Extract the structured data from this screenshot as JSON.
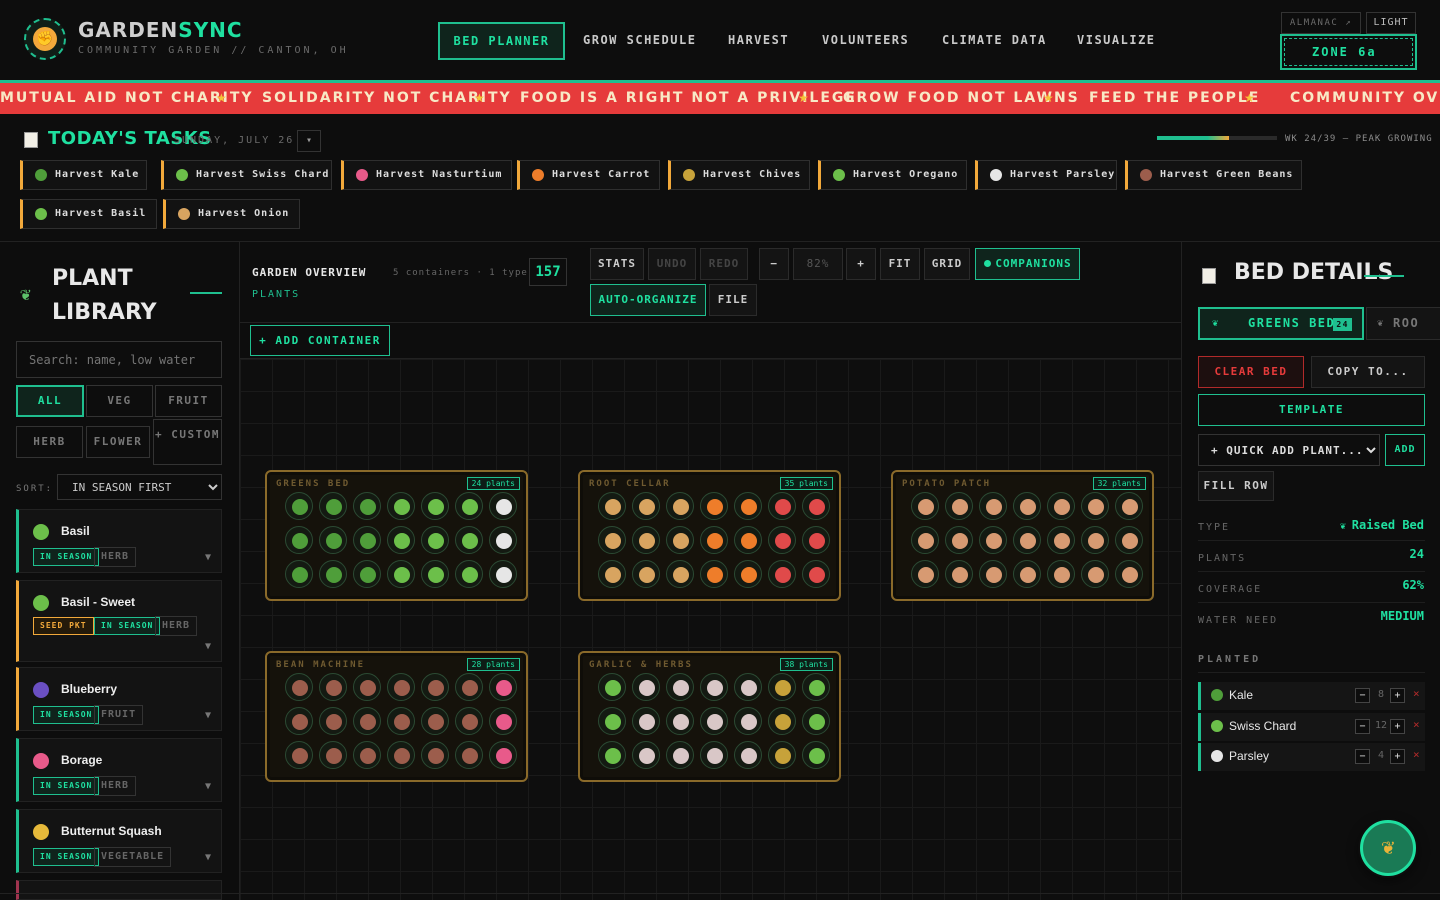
{
  "header": {
    "brand_a": "GARDEN",
    "brand_b": "SYNC",
    "subtitle": "COMMUNITY GARDEN // CANTON, OH",
    "nav": [
      "BED PLANNER",
      "GROW SCHEDULE",
      "HARVEST",
      "VOLUNTEERS",
      "CLIMATE DATA",
      "VISUALIZE"
    ],
    "almanac": "ALMANAC ↗",
    "light": "LIGHT",
    "zone": "ZONE 6a"
  },
  "banner": [
    "MUTUAL AID NOT CHARITY",
    "SOLIDARITY NOT CHARITY",
    "FOOD IS A RIGHT NOT A PRIVILEGE",
    "GROW FOOD NOT LAWNS",
    "FEED THE PEOPLE",
    "COMMUNITY OVER PR"
  ],
  "banner_star": "★",
  "tasks": {
    "title": "TODAY'S TASKS",
    "date": "SUNDAY, JULY 26",
    "arrow": "▾",
    "week_text": "WK 24/39 — PEAK GROWING",
    "week_progress": 0.6,
    "items": [
      "Harvest Kale",
      "Harvest Swiss Chard",
      "Harvest Nasturtium",
      "Harvest Carrot",
      "Harvest Chives",
      "Harvest Oregano",
      "Harvest Parsley",
      "Harvest Green Beans",
      "Harvest Basil",
      "Harvest Onion"
    ]
  },
  "library": {
    "title_1": "PLANT",
    "title_2": "LIBRARY",
    "search_placeholder": "Search: name, low water",
    "filters": [
      "ALL",
      "VEG",
      "FRUIT",
      "HERB",
      "FLOWER",
      "+ CUSTOM"
    ],
    "sort_label": "SORT:",
    "sort_value": "IN SEASON FIRST",
    "chevron": "▼",
    "plants": [
      {
        "name": "Basil",
        "tags": [
          "IN SEASON"
        ],
        "category": "HERB"
      },
      {
        "name": "Basil - Sweet",
        "tags": [
          "SEED PKT",
          "IN SEASON"
        ],
        "category": "HERB"
      },
      {
        "name": "Blueberry",
        "tags": [
          "IN SEASON"
        ],
        "category": "FRUIT"
      },
      {
        "name": "Borage",
        "tags": [
          "IN SEASON"
        ],
        "category": "HERB"
      },
      {
        "name": "Butternut Squash",
        "tags": [
          "IN SEASON"
        ],
        "category": "VEGETABLE"
      }
    ]
  },
  "main": {
    "overview_title": "GARDEN OVERVIEW",
    "overview_meta": "5 containers · 1 type",
    "plants_count": "157",
    "plants_label": "PLANTS",
    "toolbar": {
      "stats": "STATS",
      "undo": "UNDO",
      "redo": "REDO",
      "minus": "−",
      "zoom": "82%",
      "plus": "+",
      "fit": "FIT",
      "grid": "GRID",
      "companions": "COMPANIONS",
      "auto_organize": "AUTO-ORGANIZE",
      "file": "FILE"
    },
    "add_container": "+ ADD CONTAINER",
    "beds": [
      {
        "name": "GREENS BED",
        "count": "24 plants"
      },
      {
        "name": "ROOT CELLAR",
        "count": "35 plants"
      },
      {
        "name": "POTATO PATCH",
        "count": "32 plants"
      },
      {
        "name": "BEAN MACHINE",
        "count": "28 plants"
      },
      {
        "name": "GARLIC & HERBS",
        "count": "38 plants"
      }
    ]
  },
  "details": {
    "title": "BED DETAILS",
    "active_tab": "GREENS BED",
    "active_count": "24",
    "next_tab": "ROO",
    "clear_bed": "CLEAR BED",
    "copy_to": "COPY TO...",
    "template": "TEMPLATE",
    "quick_add": "+ QUICK ADD PLANT...",
    "add": "ADD",
    "fill_row": "FILL ROW",
    "stats": [
      {
        "label": "TYPE",
        "value": "Raised Bed"
      },
      {
        "label": "PLANTS",
        "value": "24"
      },
      {
        "label": "COVERAGE",
        "value": "62%"
      },
      {
        "label": "WATER NEED",
        "value": "MEDIUM"
      }
    ],
    "planted_label": "PLANTED",
    "planted": [
      {
        "name": "Kale",
        "qty": "8"
      },
      {
        "name": "Swiss Chard",
        "qty": "12"
      },
      {
        "name": "Parsley",
        "qty": "4"
      }
    ],
    "minus": "−",
    "plus": "+",
    "del": "×"
  },
  "colors": {
    "accent": "#1fe0a0",
    "accent_border": "#1fbf8f",
    "banner_red": "#e63b3b",
    "task_orange": "#f2a93b",
    "bed_border": "#8a6a2a",
    "background": "#0d0d0d"
  },
  "icons": {
    "logo": "fist-icon",
    "fab": "sprout-icon",
    "tasks": "clipboard-icon",
    "details": "clipboard-icon"
  }
}
